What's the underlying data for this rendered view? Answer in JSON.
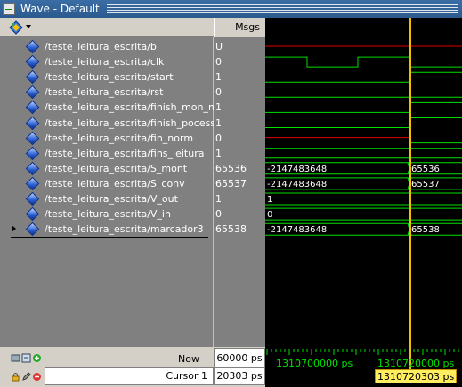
{
  "window": {
    "title": "Wave - Default"
  },
  "header": {
    "msgs_label": "Msgs"
  },
  "toolbar": {
    "signal_icon": "wave-group-icon"
  },
  "signals": [
    {
      "name": "/teste_leitura_escrita/b",
      "value": "U",
      "wave_start": "",
      "wave_end": "",
      "expandable": false
    },
    {
      "name": "/teste_leitura_escrita/clk",
      "value": "0",
      "wave_start": "",
      "wave_end": "",
      "expandable": false
    },
    {
      "name": "/teste_leitura_escrita/start",
      "value": "1",
      "wave_start": "",
      "wave_end": "",
      "expandable": false
    },
    {
      "name": "/teste_leitura_escrita/rst",
      "value": "0",
      "wave_start": "",
      "wave_end": "",
      "expandable": false
    },
    {
      "name": "/teste_leitura_escrita/finish_mon_mat",
      "value": "1",
      "wave_start": "",
      "wave_end": "",
      "expandable": false
    },
    {
      "name": "/teste_leitura_escrita/finish_pocess",
      "value": "1",
      "wave_start": "",
      "wave_end": "",
      "expandable": false
    },
    {
      "name": "/teste_leitura_escrita/fin_norm",
      "value": "0",
      "wave_start": "",
      "wave_end": "",
      "expandable": false
    },
    {
      "name": "/teste_leitura_escrita/fins_leitura",
      "value": "1",
      "wave_start": "",
      "wave_end": "",
      "expandable": false
    },
    {
      "name": "/teste_leitura_escrita/S_mont",
      "value": "65536",
      "wave_start": "-2147483648",
      "wave_end": "65536",
      "expandable": false
    },
    {
      "name": "/teste_leitura_escrita/S_conv",
      "value": "65537",
      "wave_start": "-2147483648",
      "wave_end": "65537",
      "expandable": false
    },
    {
      "name": "/teste_leitura_escrita/V_out",
      "value": "1",
      "wave_start": "1",
      "wave_end": "",
      "expandable": false
    },
    {
      "name": "/teste_leitura_escrita/V_in",
      "value": "0",
      "wave_start": "0",
      "wave_end": "",
      "expandable": false
    },
    {
      "name": "/teste_leitura_escrita/marcador3",
      "value": "65538",
      "wave_start": "-2147483648",
      "wave_end": "65538",
      "expandable": true
    }
  ],
  "status": {
    "now_label": "Now",
    "now_value": "60000 ps",
    "cursor_label": "Cursor 1",
    "cursor_value": "20303 ps",
    "timeline_tick_1": "1310700000 ps",
    "timeline_tick_2": "1310720000 ps",
    "cursor_time": "1310720303 ps"
  },
  "colors": {
    "wave_green": "#00e000",
    "wave_red": "#e00000",
    "cursor": "#f0c000",
    "panel_bg": "#808080",
    "wave_bg": "#000000"
  }
}
